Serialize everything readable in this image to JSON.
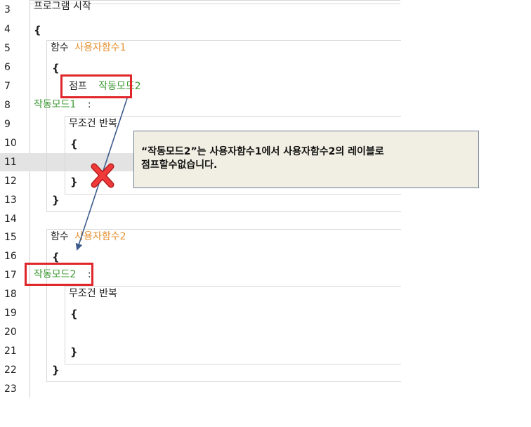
{
  "line_numbers": [
    "3",
    "4",
    "5",
    "6",
    "7",
    "8",
    "9",
    "10",
    "11",
    "12",
    "13",
    "14",
    "15",
    "16",
    "17",
    "18",
    "19",
    "20",
    "21",
    "22",
    "23"
  ],
  "code": {
    "program_start": "프로그램 시작",
    "open_brace": "{",
    "close_brace": "}",
    "func_keyword": "함수",
    "func1_name": "사용자함수1",
    "func2_name": "사용자함수2",
    "jump_keyword": "점프",
    "jump_target": "작동모드2",
    "label1": "작동모드1",
    "label2": "작동모드2",
    "colon": ":",
    "loop_keyword": "무조건 반복"
  },
  "callout": {
    "line1": "“작동모드2”는 사용자함수1에서 사용자함수2의 레이블로",
    "line2": "점프할수없습니다."
  },
  "colors": {
    "function_name": "#e69232",
    "label": "#3c9a32",
    "highlight_box": "#e0262a",
    "arrow": "#3d5a8c",
    "callout_bg": "#f1efe3",
    "callout_border": "#6d7e96"
  }
}
